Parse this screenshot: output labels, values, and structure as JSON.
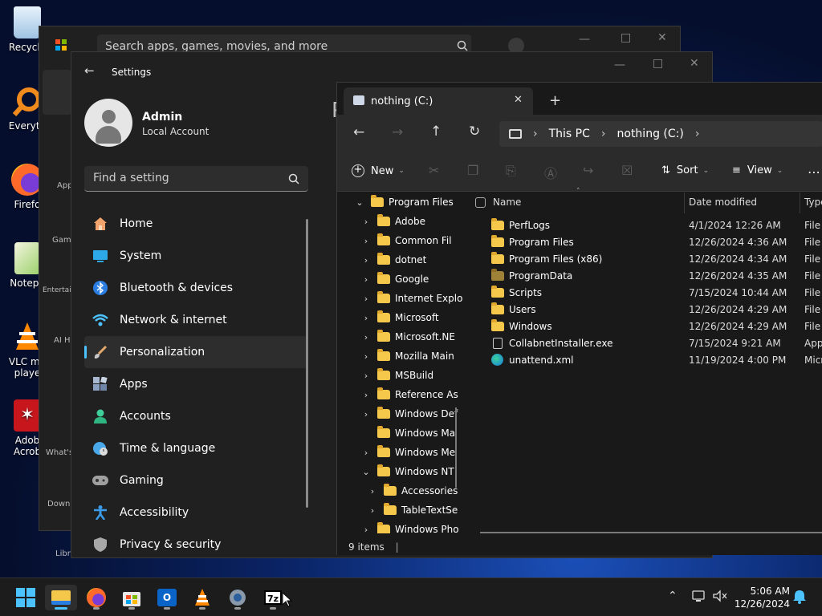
{
  "desktop": {
    "icons": [
      {
        "label": "Recycle"
      },
      {
        "label": "Everyth"
      },
      {
        "label": "Firefo"
      },
      {
        "label": "Notepa"
      },
      {
        "label": "VLC me\nplaye"
      },
      {
        "label": "Adob\nAcrob"
      }
    ]
  },
  "store": {
    "search_placeholder": "Search apps, games, movies, and more",
    "nav": [
      "Apps",
      "Gam",
      "Entertai",
      "AI H",
      "What's",
      "Down",
      "Libra"
    ]
  },
  "settings": {
    "title": "Settings",
    "user": {
      "name": "Admin",
      "account": "Local Account"
    },
    "search_placeholder": "Find a setting",
    "page_heading_fragment": "P",
    "nav": [
      {
        "label": "Home",
        "icon": "home-icon",
        "color": "#f2a36c"
      },
      {
        "label": "System",
        "icon": "system-icon",
        "color": "#2da8e8"
      },
      {
        "label": "Bluetooth & devices",
        "icon": "bluetooth-icon",
        "color": "#2a7de1"
      },
      {
        "label": "Network & internet",
        "icon": "wifi-icon",
        "color": "#4cc2ff"
      },
      {
        "label": "Personalization",
        "icon": "brush-icon",
        "color": "#e0a86a",
        "active": true
      },
      {
        "label": "Apps",
        "icon": "apps-icon",
        "color": "#8aa0c0"
      },
      {
        "label": "Accounts",
        "icon": "accounts-icon",
        "color": "#3ecf9a"
      },
      {
        "label": "Time & language",
        "icon": "globe-clock-icon",
        "color": "#4aa8e8"
      },
      {
        "label": "Gaming",
        "icon": "gamepad-icon",
        "color": "#a0a0a0"
      },
      {
        "label": "Accessibility",
        "icon": "accessibility-icon",
        "color": "#3b9be8"
      },
      {
        "label": "Privacy & security",
        "icon": "shield-icon",
        "color": "#a8a8a8"
      }
    ]
  },
  "explorer": {
    "tab_title": "nothing (C:)",
    "breadcrumb": [
      "This PC",
      "nothing (C:)"
    ],
    "commands": {
      "new": "New",
      "sort": "Sort",
      "view": "View"
    },
    "tree": [
      {
        "label": "Program Files",
        "indent": 0,
        "expanded": true
      },
      {
        "label": "Adobe",
        "indent": 1
      },
      {
        "label": "Common Fil",
        "indent": 1
      },
      {
        "label": "dotnet",
        "indent": 1
      },
      {
        "label": "Google",
        "indent": 1
      },
      {
        "label": "Internet Explo",
        "indent": 1
      },
      {
        "label": "Microsoft",
        "indent": 1
      },
      {
        "label": "Microsoft.NE",
        "indent": 1
      },
      {
        "label": "Mozilla Main",
        "indent": 1
      },
      {
        "label": "MSBuild",
        "indent": 1
      },
      {
        "label": "Reference As",
        "indent": 1
      },
      {
        "label": "Windows Def",
        "indent": 1
      },
      {
        "label": "Windows Ma",
        "indent": 1,
        "nochev": true
      },
      {
        "label": "Windows Me",
        "indent": 1
      },
      {
        "label": "Windows NT",
        "indent": 1,
        "expanded": true
      },
      {
        "label": "Accessories",
        "indent": 2
      },
      {
        "label": "TableTextSe",
        "indent": 2
      },
      {
        "label": "Windows Pho",
        "indent": 1
      }
    ],
    "columns": {
      "name": "Name",
      "date": "Date modified",
      "type": "Type"
    },
    "files": [
      {
        "name": "PerfLogs",
        "date": "4/1/2024 12:26 AM",
        "type": "File f",
        "kind": "folder"
      },
      {
        "name": "Program Files",
        "date": "12/26/2024 4:36 AM",
        "type": "File f",
        "kind": "folder"
      },
      {
        "name": "Program Files (x86)",
        "date": "12/26/2024 4:34 AM",
        "type": "File f",
        "kind": "folder"
      },
      {
        "name": "ProgramData",
        "date": "12/26/2024 4:35 AM",
        "type": "File f",
        "kind": "folder-dim"
      },
      {
        "name": "Scripts",
        "date": "7/15/2024 10:44 AM",
        "type": "File f",
        "kind": "folder"
      },
      {
        "name": "Users",
        "date": "12/26/2024 4:29 AM",
        "type": "File f",
        "kind": "folder"
      },
      {
        "name": "Windows",
        "date": "12/26/2024 4:29 AM",
        "type": "File f",
        "kind": "folder"
      },
      {
        "name": "CollabnetInstaller.exe",
        "date": "7/15/2024 9:21 AM",
        "type": "Appl",
        "kind": "exe"
      },
      {
        "name": "unattend.xml",
        "date": "11/19/2024 4:00 PM",
        "type": "Micr",
        "kind": "xml"
      }
    ],
    "status": "9 items"
  },
  "taskbar": {
    "time": "5:06 AM",
    "date": "12/26/2024"
  }
}
